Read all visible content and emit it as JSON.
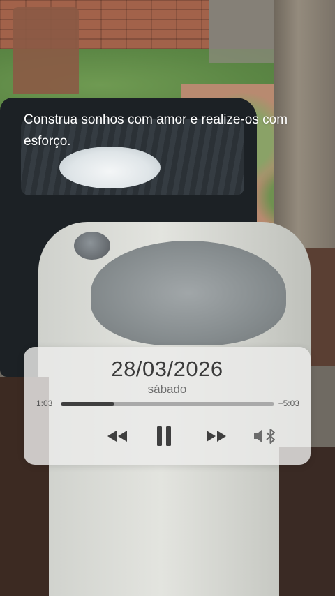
{
  "caption": {
    "text": "Construa sonhos com amor e realize-os com esforço."
  },
  "player": {
    "date": "28/03/2026",
    "weekday": "sábado",
    "elapsed": "1:03",
    "remaining": "−5:03",
    "progress_fraction": 0.25,
    "controls": {
      "rewind_icon": "rewind-icon",
      "pause_icon": "pause-icon",
      "forward_icon": "fast-forward-icon",
      "output_icon": "bluetooth-speaker-icon"
    },
    "colors": {
      "panel": "#ececea",
      "text": "#3b3b3b",
      "track": "#a9a9a9",
      "fill": "#3f3f3f"
    }
  }
}
